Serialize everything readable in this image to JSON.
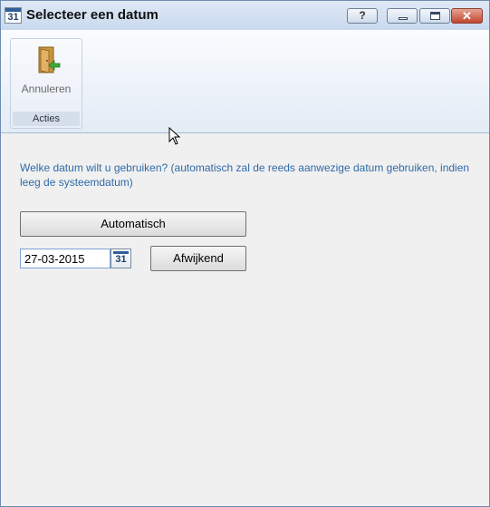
{
  "window": {
    "title": "Selecteer een datum",
    "app_icon_text": "31",
    "help_label": "?",
    "close_glyph": "✕",
    "icons": {
      "help": "help-icon",
      "minimize": "minimize-icon",
      "maximize": "maximize-icon",
      "close": "close-icon"
    }
  },
  "ribbon": {
    "cancel_label": "Annuleren",
    "cancel_icon": "exit-door-icon",
    "group_label": "Acties"
  },
  "content": {
    "instruction": "Welke datum wilt u gebruiken? (automatisch zal de reeds aanwezige datum gebruiken, indien leeg de systeemdatum)",
    "automatic_label": "Automatisch",
    "date_value": "27-03-2015",
    "calendar_icon_text": "31",
    "deviate_label": "Afwijkend"
  },
  "colors": {
    "instruction_text": "#2f6aa8",
    "title_bar": "#c9d9ee",
    "close_button": "#c1462f"
  }
}
